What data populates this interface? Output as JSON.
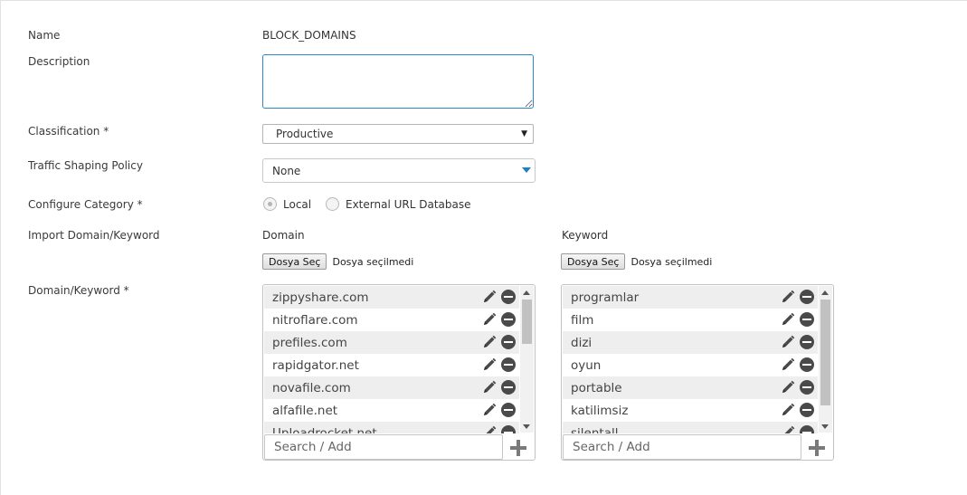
{
  "labels": {
    "name": "Name",
    "description": "Description",
    "classification": "Classification *",
    "traffic_shaping": "Traffic Shaping Policy",
    "configure_category": "Configure Category *",
    "import": "Import Domain/Keyword",
    "domain_keyword": "Domain/Keyword *"
  },
  "name_value": "BLOCK_DOMAINS",
  "description_value": "",
  "classification": {
    "selected": "Productive"
  },
  "traffic_shaping": {
    "selected": "None"
  },
  "category": {
    "local": "Local",
    "external": "External URL Database",
    "selected": "local"
  },
  "import": {
    "domain_heading": "Domain",
    "keyword_heading": "Keyword",
    "choose_file": "Dosya Seç",
    "no_file": "Dosya seçilmedi"
  },
  "domains": [
    "zippyshare.com",
    "nitroflare.com",
    "prefiles.com",
    "rapidgator.net",
    "novafile.com",
    "alfafile.net",
    "Uploadrocket.net"
  ],
  "keywords": [
    "programlar",
    "film",
    "dizi",
    "oyun",
    "portable",
    "katilimsiz",
    "silentall"
  ],
  "search_placeholder": "Search / Add",
  "colors": {
    "accent": "#2e86c7",
    "dropdown_arrow": "#1f7fc2",
    "row_alt": "#eeeeee"
  },
  "scroll": {
    "domain_thumb_fraction": 0.36,
    "keyword_thumb_fraction": 0.86
  }
}
